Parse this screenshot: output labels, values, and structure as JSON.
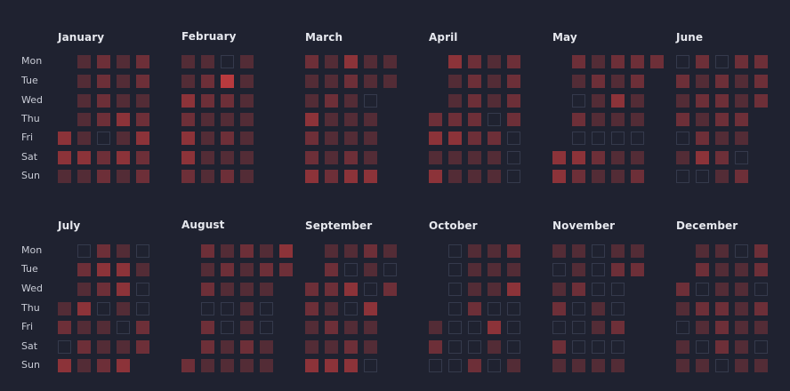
{
  "chart_data": {
    "type": "heatmap",
    "day_labels": [
      "Mon",
      "Tue",
      "Wed",
      "Thu",
      "Fri",
      "Sat",
      "Sun"
    ],
    "scale": {
      "levels": [
        0,
        1,
        2,
        3,
        4,
        5
      ],
      "empty_level": 0
    },
    "colors": {
      "background": "#1f2230",
      "empty_border": "#353a4c",
      "levels": [
        "#1f2230",
        "#3d2a35",
        "#532c36",
        "#6d2f38",
        "#8c3339",
        "#b83a3e"
      ]
    },
    "months": [
      {
        "name": "January",
        "start_col": 1,
        "grid": [
          [
            -1,
            2,
            3,
            2,
            3
          ],
          [
            -1,
            2,
            3,
            2,
            3
          ],
          [
            -1,
            2,
            3,
            2,
            2
          ],
          [
            -1,
            2,
            3,
            4,
            3
          ],
          [
            4,
            2,
            0,
            2,
            4
          ],
          [
            4,
            4,
            3,
            4,
            3
          ],
          [
            2,
            2,
            3,
            2,
            3
          ]
        ]
      },
      {
        "name": "February",
        "start_col": 0,
        "grid": [
          [
            2,
            2,
            0,
            2,
            -1
          ],
          [
            2,
            3,
            5,
            2,
            -1
          ],
          [
            4,
            3,
            3,
            2,
            -1
          ],
          [
            3,
            2,
            2,
            2,
            -1
          ],
          [
            4,
            2,
            3,
            2,
            -1
          ],
          [
            4,
            2,
            2,
            2,
            -1
          ],
          [
            3,
            2,
            3,
            2,
            -1
          ]
        ]
      },
      {
        "name": "March",
        "start_col": 0,
        "grid": [
          [
            3,
            2,
            4,
            2,
            2
          ],
          [
            2,
            2,
            3,
            2,
            2
          ],
          [
            2,
            3,
            2,
            0,
            -1
          ],
          [
            4,
            2,
            2,
            2,
            -1
          ],
          [
            3,
            2,
            2,
            2,
            -1
          ],
          [
            3,
            2,
            3,
            2,
            -1
          ],
          [
            4,
            3,
            4,
            4,
            -1
          ]
        ]
      },
      {
        "name": "April",
        "start_col": 1,
        "grid": [
          [
            -1,
            4,
            3,
            2,
            3
          ],
          [
            -1,
            2,
            3,
            2,
            3
          ],
          [
            -1,
            2,
            3,
            2,
            3
          ],
          [
            3,
            3,
            3,
            0,
            3
          ],
          [
            4,
            4,
            3,
            3,
            0
          ],
          [
            2,
            2,
            2,
            2,
            0
          ],
          [
            4,
            2,
            2,
            2,
            0
          ]
        ]
      },
      {
        "name": "May",
        "start_col": 1,
        "grid": [
          [
            -1,
            3,
            2,
            3,
            3,
            3
          ],
          [
            -1,
            2,
            3,
            2,
            3,
            -1
          ],
          [
            -1,
            0,
            2,
            4,
            2,
            -1
          ],
          [
            -1,
            3,
            2,
            2,
            2,
            -1
          ],
          [
            -1,
            0,
            0,
            0,
            0,
            -1
          ],
          [
            4,
            4,
            3,
            2,
            2,
            -1
          ],
          [
            4,
            3,
            2,
            2,
            3,
            -1
          ]
        ]
      },
      {
        "name": "June",
        "start_col": 0,
        "grid": [
          [
            0,
            3,
            0,
            3,
            3
          ],
          [
            3,
            2,
            3,
            2,
            3
          ],
          [
            2,
            3,
            3,
            2,
            3
          ],
          [
            3,
            2,
            3,
            3,
            -1
          ],
          [
            0,
            3,
            2,
            2,
            -1
          ],
          [
            2,
            4,
            3,
            0,
            -1
          ],
          [
            0,
            0,
            2,
            3,
            -1
          ]
        ]
      },
      {
        "name": "July",
        "start_col": 0,
        "grid": [
          [
            -1,
            0,
            3,
            2,
            0
          ],
          [
            -1,
            3,
            4,
            4,
            2
          ],
          [
            -1,
            2,
            3,
            4,
            0
          ],
          [
            2,
            4,
            0,
            2,
            0
          ],
          [
            3,
            2,
            2,
            0,
            3
          ],
          [
            0,
            3,
            2,
            2,
            3
          ],
          [
            4,
            2,
            3,
            4,
            -1
          ]
        ]
      },
      {
        "name": "August",
        "start_col": 0,
        "grid": [
          [
            -1,
            3,
            2,
            3,
            2,
            4
          ],
          [
            -1,
            2,
            3,
            2,
            3,
            3
          ],
          [
            -1,
            3,
            2,
            2,
            2,
            -1
          ],
          [
            -1,
            0,
            0,
            2,
            0,
            -1
          ],
          [
            -1,
            3,
            0,
            2,
            0,
            -1
          ],
          [
            -1,
            3,
            2,
            3,
            2,
            -1
          ],
          [
            3,
            2,
            2,
            2,
            2,
            -1
          ]
        ]
      },
      {
        "name": "September",
        "start_col": 0,
        "grid": [
          [
            -1,
            2,
            2,
            3,
            2
          ],
          [
            -1,
            3,
            0,
            2,
            0
          ],
          [
            3,
            3,
            4,
            0,
            3
          ],
          [
            3,
            2,
            0,
            4,
            -1
          ],
          [
            2,
            3,
            2,
            2,
            -1
          ],
          [
            2,
            2,
            3,
            2,
            -1
          ],
          [
            4,
            4,
            4,
            0,
            -1
          ]
        ]
      },
      {
        "name": "October",
        "start_col": 0,
        "grid": [
          [
            -1,
            0,
            2,
            2,
            3
          ],
          [
            -1,
            0,
            2,
            2,
            2
          ],
          [
            -1,
            0,
            2,
            2,
            4
          ],
          [
            -1,
            0,
            3,
            0,
            0
          ],
          [
            2,
            0,
            0,
            4,
            0
          ],
          [
            3,
            0,
            0,
            2,
            0
          ],
          [
            0,
            0,
            3,
            0,
            2
          ]
        ]
      },
      {
        "name": "November",
        "start_col": 0,
        "grid": [
          [
            2,
            2,
            0,
            2,
            2
          ],
          [
            0,
            2,
            0,
            3,
            3
          ],
          [
            2,
            3,
            0,
            0,
            -1
          ],
          [
            3,
            0,
            2,
            0,
            -1
          ],
          [
            0,
            0,
            2,
            3,
            -1
          ],
          [
            3,
            0,
            0,
            0,
            -1
          ],
          [
            2,
            2,
            2,
            2,
            -1
          ]
        ]
      },
      {
        "name": "December",
        "start_col": 0,
        "grid": [
          [
            -1,
            2,
            2,
            0,
            3
          ],
          [
            -1,
            3,
            2,
            2,
            3
          ],
          [
            3,
            0,
            2,
            2,
            0
          ],
          [
            2,
            3,
            3,
            2,
            3
          ],
          [
            0,
            2,
            3,
            2,
            2
          ],
          [
            2,
            0,
            3,
            2,
            0
          ],
          [
            2,
            2,
            0,
            2,
            2
          ]
        ]
      }
    ]
  }
}
